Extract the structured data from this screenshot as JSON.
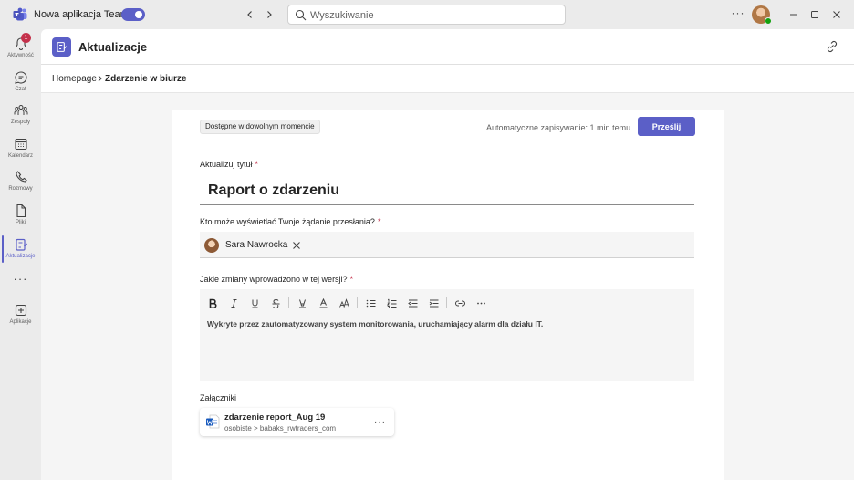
{
  "titlebar": {
    "app_name": "Nowa aplikacja Teams",
    "toggle_on": true,
    "search_placeholder": "Wyszukiwanie",
    "more_label": "···"
  },
  "rail": {
    "items": [
      {
        "label": "Aktywność",
        "icon": "bell-icon",
        "badge": "1"
      },
      {
        "label": "Czat",
        "icon": "chat-icon"
      },
      {
        "label": "Zespoły",
        "icon": "teams-icon"
      },
      {
        "label": "Kalendarz",
        "icon": "calendar-icon"
      },
      {
        "label": "Rozmowy",
        "icon": "phone-icon"
      },
      {
        "label": "Pliki",
        "icon": "file-icon"
      },
      {
        "label": "Aktualizacje",
        "icon": "updates-icon",
        "active": true
      },
      {
        "label": "Aplikacje",
        "icon": "apps-icon"
      }
    ],
    "more_label": "···"
  },
  "header": {
    "title": "Aktualizacje"
  },
  "breadcrumb": {
    "home": "Homepage",
    "current": "Zdarzenie w biurze"
  },
  "form": {
    "availability": "Dostępne w dowolnym momencie",
    "autosave": "Automatyczne zapisywanie: 1 min temu",
    "submit_label": "Prześlij",
    "title_label": "Aktualizuj tytuł",
    "title_value": "Raport o zdarzeniu",
    "viewers_label": "Kto może wyświetlać Twoje żądanie przesłania?",
    "viewer_name": "Sara Nawrocka",
    "changes_label": "Jakie zmiany wprowadzono w tej wersji?",
    "changes_text": "Wykryte przez zautomatyzowany system monitorowania, uruchamiający alarm dla działu IT.",
    "required_mark": "*",
    "attachments_label": "Załączniki",
    "attachment": {
      "name": "zdarzenie report_Aug 19",
      "path": "osobiste > babaks_rwtraders_com",
      "more_label": "···"
    }
  },
  "colors": {
    "accent": "#5b5fc7",
    "badge": "#c4314b",
    "presence": "#13a10e",
    "word": "#185abd"
  }
}
